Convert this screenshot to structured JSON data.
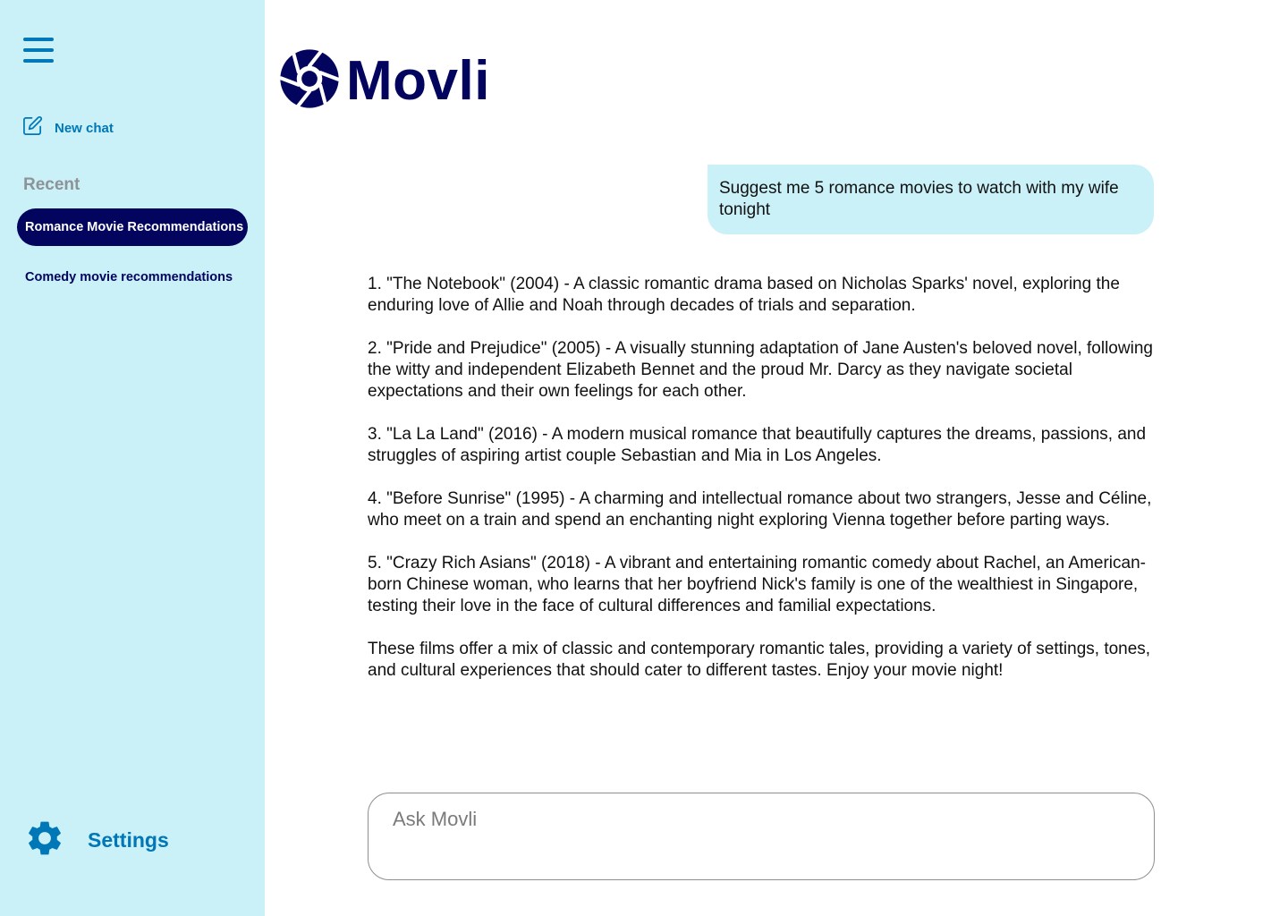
{
  "sidebar": {
    "new_chat_label": "New chat",
    "recent_label": "Recent",
    "chats": [
      {
        "label": "Romance Movie Recommendations",
        "active": true
      },
      {
        "label": "Comedy movie recommendations",
        "active": false
      }
    ],
    "settings_label": "Settings",
    "icons": {
      "menu": "hamburger-menu-icon",
      "new_chat": "edit-icon",
      "settings": "gear-icon"
    }
  },
  "header": {
    "app_name": "Movli",
    "logo_icon": "camera-aperture-icon"
  },
  "conversation": {
    "user_message": "Suggest me 5 romance movies to watch with my wife tonight",
    "assistant_paragraphs": [
      "1. \"The Notebook\" (2004) - A classic romantic drama based on Nicholas Sparks' novel, exploring the enduring love of Allie and Noah through decades of trials and separation.",
      "2. \"Pride and Prejudice\" (2005) - A visually stunning adaptation of Jane Austen's beloved novel, following the witty and independent Elizabeth Bennet and the proud Mr. Darcy as they navigate societal expectations and their own feelings for each other.",
      "3. \"La La Land\" (2016) - A modern musical romance that beautifully captures the dreams, passions, and struggles of aspiring artist couple Sebastian and Mia in Los Angeles.",
      "4. \"Before Sunrise\" (1995) - A charming and intellectual romance about two strangers, Jesse and Céline, who meet on a train and spend an enchanting night exploring Vienna together before parting ways.",
      "5. \"Crazy Rich Asians\" (2018) - A vibrant and entertaining romantic comedy about Rachel, an American-born Chinese woman, who learns that her boyfriend Nick's family is one of the wealthiest in Singapore, testing their love in the face of cultural differences and familial expectations.",
      "These films offer a mix of classic and contemporary romantic tales, providing a variety of settings, tones, and cultural experiences that should cater to different tastes. Enjoy your movie night!"
    ]
  },
  "input": {
    "placeholder": "Ask Movli",
    "value": ""
  },
  "colors": {
    "sidebar_bg": "#caf0f8",
    "accent_blue": "#0077b6",
    "navy": "#03045e",
    "muted_gray": "#8d9396",
    "bubble_bg": "#caf0f8"
  }
}
